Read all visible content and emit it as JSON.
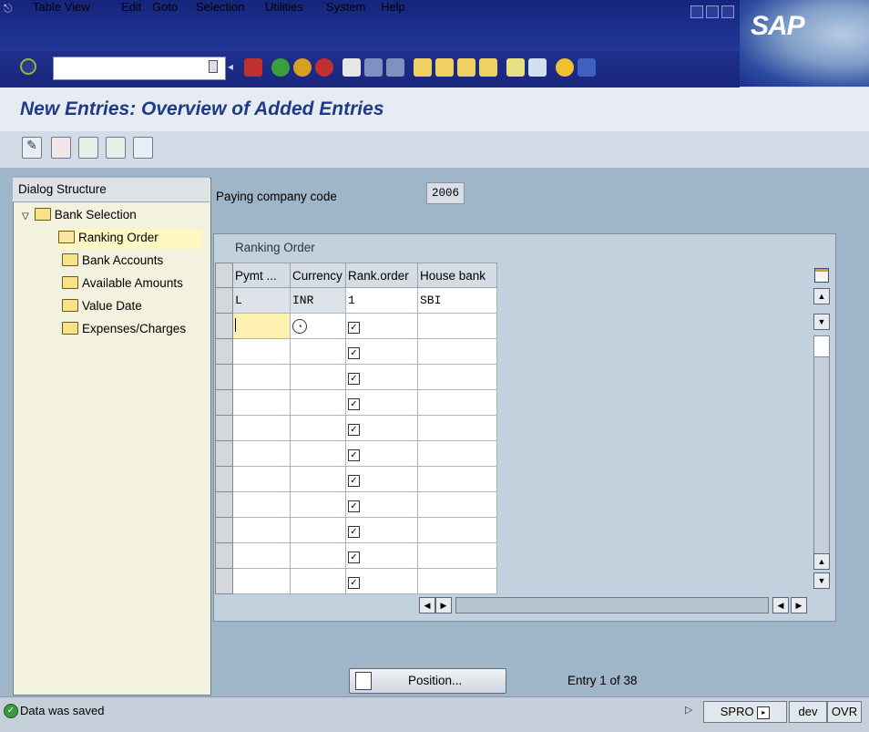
{
  "menu": {
    "items": [
      "Table View",
      "Edit",
      "Goto",
      "Selection",
      "Utilities",
      "System",
      "Help"
    ]
  },
  "logo": "SAP",
  "command_field": {
    "value": ""
  },
  "page_title": "New Entries: Overview of Added Entries",
  "dialog_structure": {
    "header": "Dialog Structure",
    "root": "Bank Selection",
    "items": [
      "Ranking Order",
      "Bank Accounts",
      "Available Amounts",
      "Value Date",
      "Expenses/Charges"
    ],
    "selected": "Ranking Order"
  },
  "company": {
    "label": "Paying company code",
    "value": "2006"
  },
  "table": {
    "title": "Ranking Order",
    "columns": [
      "Pymt ...",
      "Currency",
      "Rank.order",
      "House bank"
    ],
    "rows": [
      {
        "pymt": "L",
        "currency": "INR",
        "rank": "1",
        "bank": "SBI"
      }
    ]
  },
  "position_button": "Position...",
  "entry_text": "Entry 1 of 38",
  "status": {
    "message": "Data was saved",
    "transaction": "SPRO",
    "system": "dev",
    "mode": "OVR"
  },
  "colors": {
    "menubar": "#1c2f8e",
    "title": "#1f3a8a",
    "content": "#9fb5c8"
  }
}
